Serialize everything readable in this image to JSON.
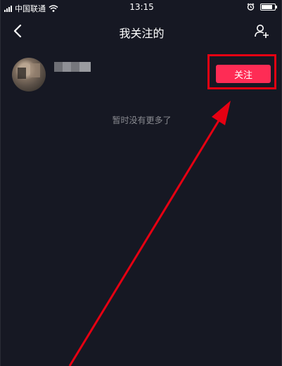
{
  "status_bar": {
    "carrier": "中国联通",
    "time": "13:15",
    "battery_level_percent": 85
  },
  "nav": {
    "title": "我关注的",
    "back_icon": "chevron-left-icon",
    "add_friend_icon": "add-user-icon"
  },
  "followed_user": {
    "name_blurred": true,
    "follow_button_label": "关注"
  },
  "list_end_text": "暂时没有更多了",
  "annotation": {
    "highlight_color": "#e60012"
  },
  "colors": {
    "background": "#161823",
    "accent": "#fe2c55",
    "muted_text": "#8a8b91"
  }
}
